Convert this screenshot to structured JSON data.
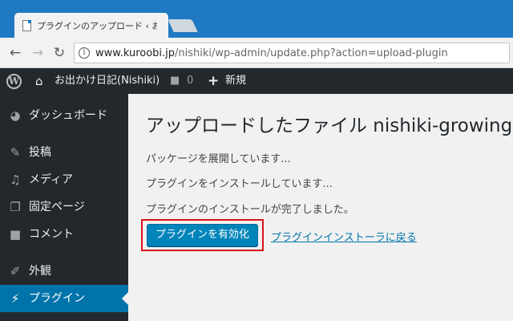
{
  "browser": {
    "tab_title": "プラグインのアップロード ‹ お出",
    "url_host": "www.kuroobi.jp",
    "url_path": "/nishiki/wp-admin/update.php?action=upload-plugin"
  },
  "admin_bar": {
    "site_name": "お出かけ日記(Nishiki)",
    "comments_count": "0",
    "new_label": "新規"
  },
  "sidebar": {
    "items": [
      {
        "label": "ダッシュボード",
        "icon": "dashboard-icon"
      },
      {
        "label": "投稿",
        "icon": "pin-icon"
      },
      {
        "label": "メディア",
        "icon": "media-icon"
      },
      {
        "label": "固定ページ",
        "icon": "pages-icon"
      },
      {
        "label": "コメント",
        "icon": "comment-icon"
      },
      {
        "label": "外観",
        "icon": "appearance-icon"
      },
      {
        "label": "プラグイン",
        "icon": "plugin-icon",
        "current": true
      }
    ]
  },
  "main": {
    "title": "アップロードしたファイル nishiki-growing-b",
    "messages": [
      "パッケージを展開しています...",
      "プラグインをインストールしています...",
      "プラグインのインストールが完了しました。"
    ],
    "activate_button": "プラグインを有効化",
    "back_link": "プラグインインストーラに戻る"
  },
  "colors": {
    "chrome_blue": "#1f7ac3",
    "admin_dark": "#23282d",
    "wp_blue": "#0073aa",
    "button_blue": "#0085ba",
    "highlight_red": "#d9141b"
  }
}
